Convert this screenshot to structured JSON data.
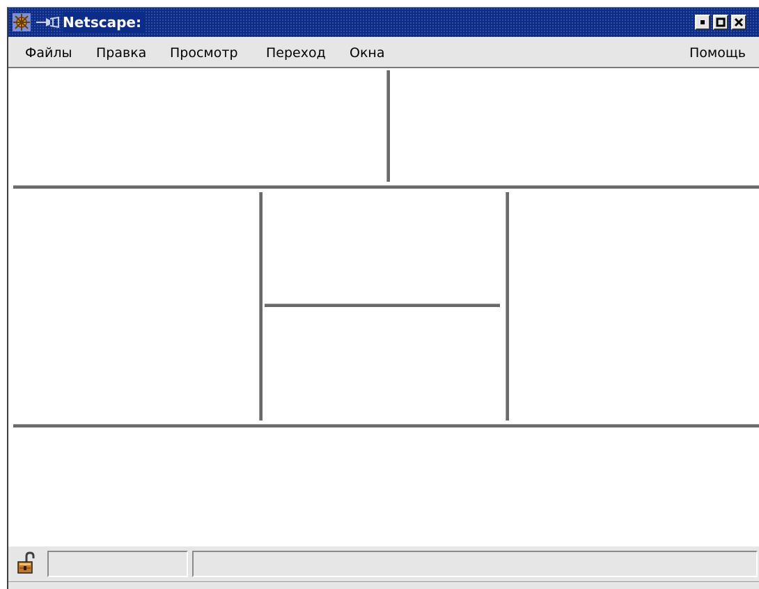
{
  "window": {
    "title": "Netscape:",
    "icons": {
      "app": "netscape-wheel-icon",
      "pin": "pin-icon",
      "minimize": "minimize-icon",
      "maximize": "maximize-icon",
      "close": "close-icon"
    }
  },
  "menu": {
    "items": [
      {
        "label": "Файлы"
      },
      {
        "label": "Правка"
      },
      {
        "label": "Просмотр"
      },
      {
        "label": "Переход"
      },
      {
        "label": "Окна"
      }
    ],
    "help": {
      "label": "Помощь"
    }
  },
  "statusbar": {
    "lock_icon": "unlocked-padlock-icon",
    "progress_text": "",
    "status_text": ""
  },
  "colors": {
    "titlebar": "#0c2c8a",
    "chrome": "#e6e6e6",
    "divider": "#6a6a6a",
    "content": "#ffffff"
  }
}
